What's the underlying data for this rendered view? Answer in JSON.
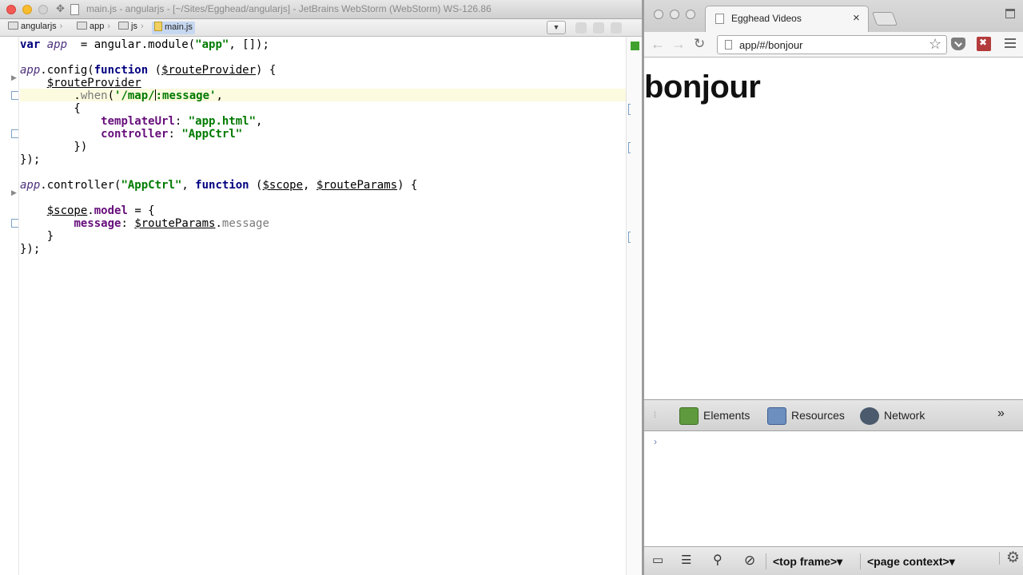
{
  "ide": {
    "title": "main.js - angularjs - [~/Sites/Egghead/angularjs] - JetBrains WebStorm (WebStorm) WS-126.86",
    "breadcrumbs": [
      "angularjs",
      "app",
      "js",
      "main.js"
    ],
    "code": [
      {
        "parts": [
          [
            "kw",
            "var "
          ],
          [
            "it",
            "app"
          ],
          [
            "",
            "  = angular.module("
          ],
          [
            "str",
            "\"app\""
          ],
          [
            "",
            ", []);"
          ]
        ]
      },
      {
        "parts": []
      },
      {
        "parts": [
          [
            "it",
            "app"
          ],
          [
            "",
            ".config("
          ],
          [
            "kw",
            "function"
          ],
          [
            "",
            " ("
          ],
          [
            "u",
            "$routeProvider"
          ],
          [
            "",
            ") {"
          ]
        ]
      },
      {
        "parts": [
          [
            "",
            "    "
          ],
          [
            "u",
            "$routeProvider"
          ]
        ]
      },
      {
        "parts": [
          [
            "",
            "        ."
          ],
          [
            "gray",
            "when"
          ],
          [
            "",
            "("
          ],
          [
            "str",
            "'/map/"
          ],
          [
            "cursor",
            ""
          ],
          [
            "str",
            ":message'"
          ],
          [
            "",
            ","
          ]
        ]
      },
      {
        "parts": [
          [
            "",
            "        {"
          ]
        ]
      },
      {
        "parts": [
          [
            "",
            "            "
          ],
          [
            "prop",
            "templateUrl"
          ],
          [
            "",
            ": "
          ],
          [
            "str",
            "\"app.html\""
          ],
          [
            "",
            ","
          ]
        ]
      },
      {
        "parts": [
          [
            "",
            "            "
          ],
          [
            "prop",
            "controller"
          ],
          [
            "",
            ": "
          ],
          [
            "str",
            "\"AppCtrl\""
          ]
        ]
      },
      {
        "parts": [
          [
            "",
            "        })"
          ]
        ]
      },
      {
        "parts": [
          [
            "",
            "});"
          ]
        ]
      },
      {
        "parts": []
      },
      {
        "parts": [
          [
            "it",
            "app"
          ],
          [
            "",
            ".controller("
          ],
          [
            "str",
            "\"AppCtrl\""
          ],
          [
            "",
            ", "
          ],
          [
            "kw",
            "function"
          ],
          [
            "",
            " ("
          ],
          [
            "u",
            "$scope"
          ],
          [
            "",
            ", "
          ],
          [
            "u",
            "$routeParams"
          ],
          [
            "",
            ") {"
          ]
        ]
      },
      {
        "parts": []
      },
      {
        "parts": [
          [
            "",
            "    "
          ],
          [
            "u",
            "$scope"
          ],
          [
            "",
            "."
          ],
          [
            "prop",
            "model"
          ],
          [
            "",
            " = {"
          ]
        ]
      },
      {
        "parts": [
          [
            "",
            "        "
          ],
          [
            "prop",
            "message"
          ],
          [
            "",
            ": "
          ],
          [
            "u",
            "$routeParams"
          ],
          [
            "",
            "."
          ],
          [
            "gray",
            "message"
          ]
        ]
      },
      {
        "parts": [
          [
            "",
            "    }"
          ]
        ]
      },
      {
        "parts": [
          [
            "",
            "});"
          ]
        ]
      }
    ]
  },
  "browser": {
    "tab_title": "Egghead Videos",
    "tab_close": "×",
    "url": "app/#/bonjour",
    "page_heading": "bonjour",
    "devtools": {
      "tabs": [
        "Elements",
        "Resources",
        "Network"
      ],
      "more": "»",
      "frame_select": "<top frame>▾",
      "context_select": "<page context>▾",
      "console_prompt": "›"
    }
  },
  "icons": {
    "back": "arrow-left",
    "forward": "arrow-right",
    "reload": "reload",
    "star": "star",
    "settings": "gear",
    "search": "magnifier",
    "clear": "no-entry"
  }
}
